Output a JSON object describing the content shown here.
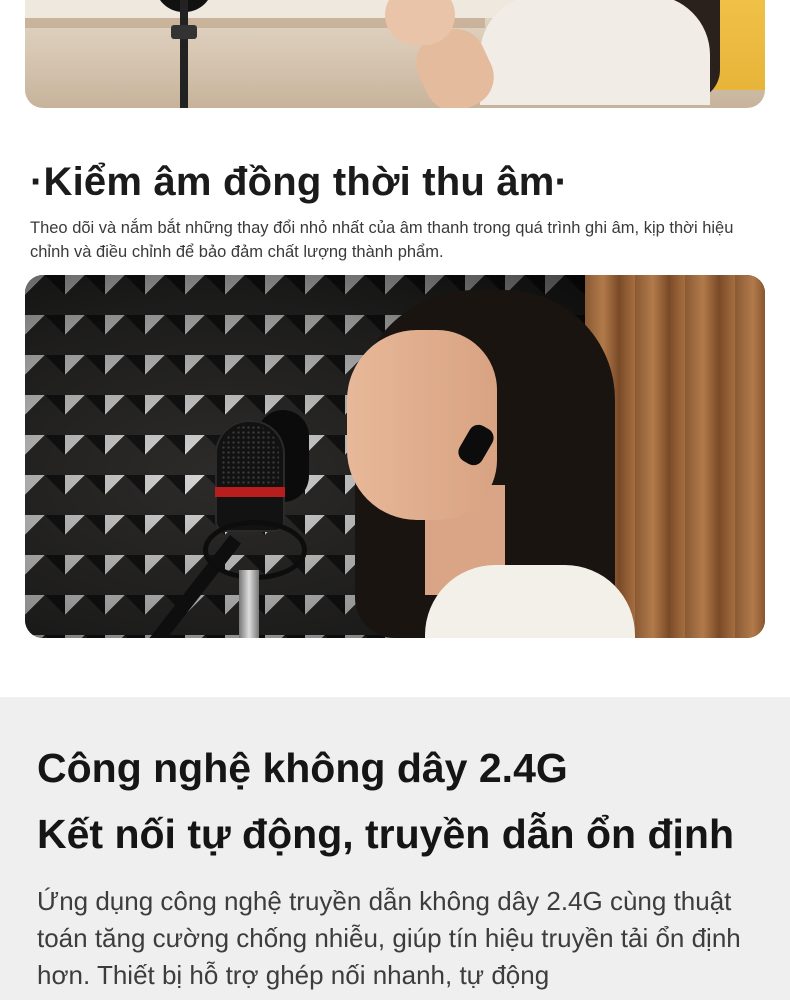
{
  "section_monitor": {
    "title": "·Kiểm âm đồng thời thu âm·",
    "description": "Theo dõi và nắm bắt những thay đổi nhỏ nhất của âm thanh trong quá trình ghi âm, kịp thời hiệu chỉnh và điều chỉnh để bảo đảm chất lượng thành phẩm."
  },
  "section_wireless": {
    "title_line1": "Công nghệ không dây 2.4G",
    "title_line2": "Kết nối tự động, truyền dẫn ổn định",
    "body": "Ứng dụng công nghệ truyền dẫn không dây 2.4G cùng thuật toán tăng cường chống nhiễu, giúp tín hiệu truyền tải ổn định hơn. Thiết bị hỗ trợ ghép nối nhanh, tự động"
  },
  "colors": {
    "heading": "#1b1b1b",
    "body_text": "#3a3a3a",
    "wireless_bg": "#efefef",
    "mic_accent": "#b81e1e"
  }
}
